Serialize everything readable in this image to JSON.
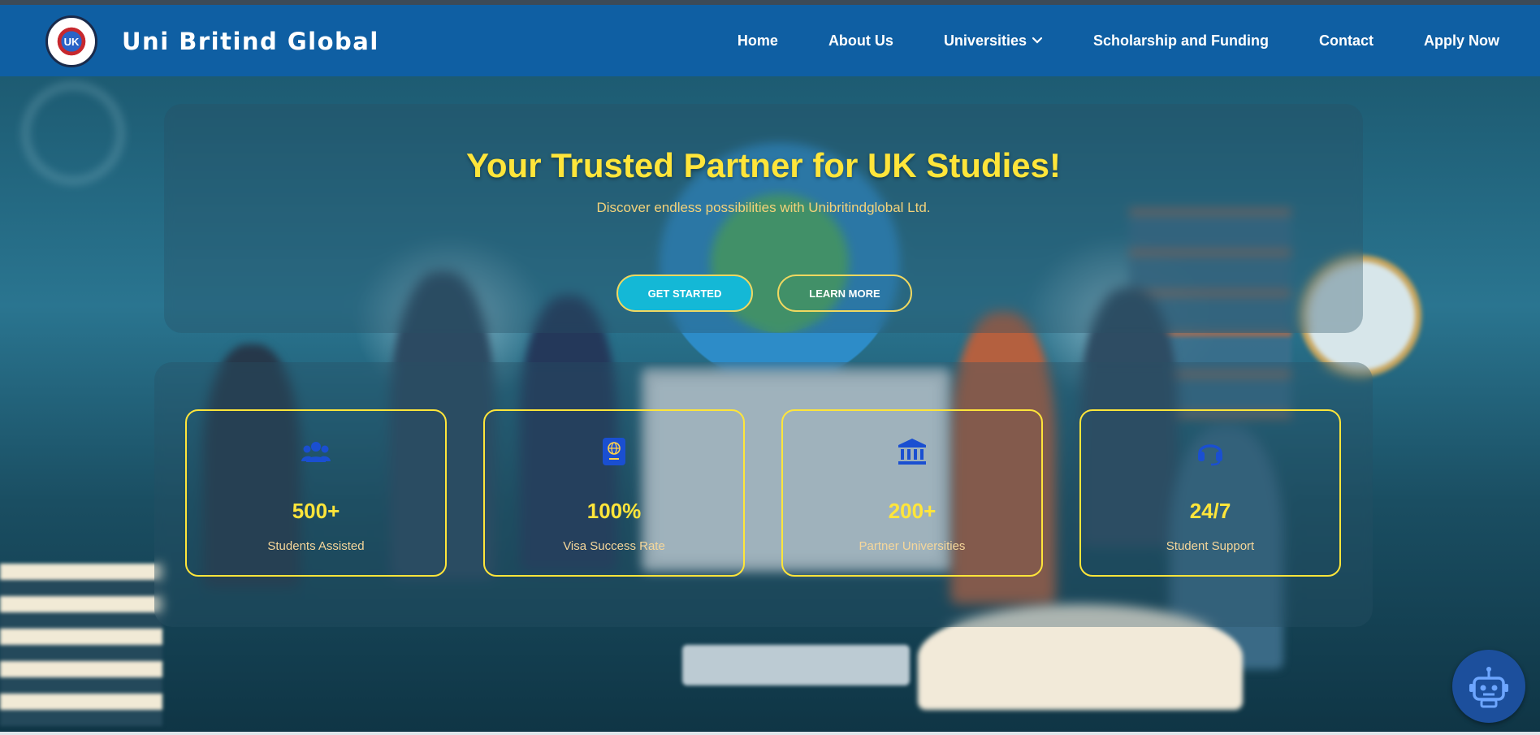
{
  "header": {
    "brand": "Uni Britind Global",
    "logo_text": "UK",
    "nav": [
      {
        "label": "Home"
      },
      {
        "label": "About Us"
      },
      {
        "label": "Universities"
      },
      {
        "label": "Scholarship and Funding"
      },
      {
        "label": "Contact"
      },
      {
        "label": "Apply Now"
      }
    ]
  },
  "hero": {
    "title": "Your Trusted Partner for UK Studies!",
    "subtitle": "Discover endless possibilities with Unibritindglobal Ltd.",
    "primary_button": "GET STARTED",
    "secondary_button": "LEARN MORE"
  },
  "stats": [
    {
      "icon": "users-icon",
      "value": "500+",
      "label": "Students Assisted"
    },
    {
      "icon": "passport-icon",
      "value": "100%",
      "label": "Visa Success Rate"
    },
    {
      "icon": "university-icon",
      "value": "200+",
      "label": "Partner Universities"
    },
    {
      "icon": "headset-icon",
      "value": "24/7",
      "label": "Student Support"
    }
  ],
  "chatbot": {
    "icon": "robot-icon"
  },
  "colors": {
    "navbar": "#0f5fa3",
    "accent_yellow": "#ffe53a",
    "primary_button": "#14b8d6",
    "icon_blue": "#1a4fd1"
  }
}
